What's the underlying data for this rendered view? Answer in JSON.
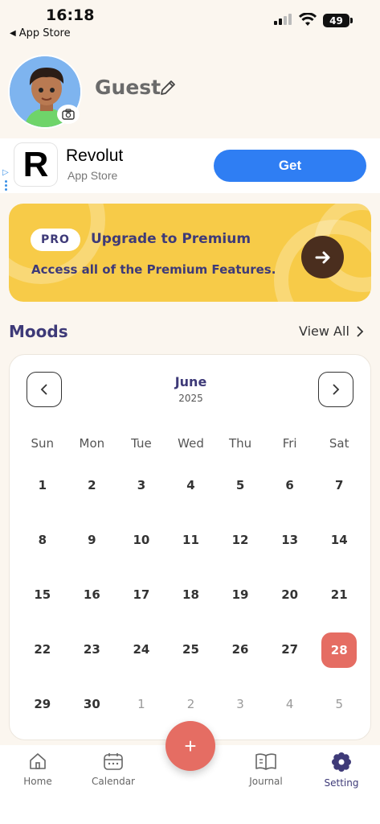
{
  "status_bar": {
    "time": "16:18",
    "back_app": "App Store",
    "battery": "49"
  },
  "profile": {
    "name": "Guest"
  },
  "ad": {
    "app_name": "Revolut",
    "store": "App Store",
    "cta": "Get",
    "logo_letter": "R"
  },
  "premium": {
    "badge": "PRO",
    "title": "Upgrade to Premium",
    "subtitle": "Access all of the Premium Features."
  },
  "moods": {
    "title": "Moods",
    "view_all": "View All"
  },
  "calendar": {
    "month": "June",
    "year": "2025",
    "weekdays": [
      "Sun",
      "Mon",
      "Tue",
      "Wed",
      "Thu",
      "Fri",
      "Sat"
    ],
    "days": [
      {
        "d": "1"
      },
      {
        "d": "2"
      },
      {
        "d": "3"
      },
      {
        "d": "4"
      },
      {
        "d": "5"
      },
      {
        "d": "6"
      },
      {
        "d": "7"
      },
      {
        "d": "8"
      },
      {
        "d": "9"
      },
      {
        "d": "10"
      },
      {
        "d": "11"
      },
      {
        "d": "12"
      },
      {
        "d": "13"
      },
      {
        "d": "14"
      },
      {
        "d": "15"
      },
      {
        "d": "16"
      },
      {
        "d": "17"
      },
      {
        "d": "18"
      },
      {
        "d": "19"
      },
      {
        "d": "20"
      },
      {
        "d": "21"
      },
      {
        "d": "22"
      },
      {
        "d": "23"
      },
      {
        "d": "24"
      },
      {
        "d": "25"
      },
      {
        "d": "26"
      },
      {
        "d": "27"
      },
      {
        "d": "28",
        "today": true
      },
      {
        "d": "29"
      },
      {
        "d": "30"
      },
      {
        "d": "1",
        "muted": true
      },
      {
        "d": "2",
        "muted": true
      },
      {
        "d": "3",
        "muted": true
      },
      {
        "d": "4",
        "muted": true
      },
      {
        "d": "5",
        "muted": true
      }
    ]
  },
  "tabs": [
    {
      "label": "Home",
      "icon": "home-icon"
    },
    {
      "label": "Calendar",
      "icon": "calendar-icon"
    },
    {
      "label": "Journal",
      "icon": "journal-icon"
    },
    {
      "label": "Setting",
      "icon": "gear-icon",
      "active": true
    }
  ],
  "fab_label": "+",
  "colors": {
    "accent": "#e56d63",
    "brand": "#3e3a78",
    "banner": "#f7cb48",
    "cta": "#2f7ef3"
  }
}
